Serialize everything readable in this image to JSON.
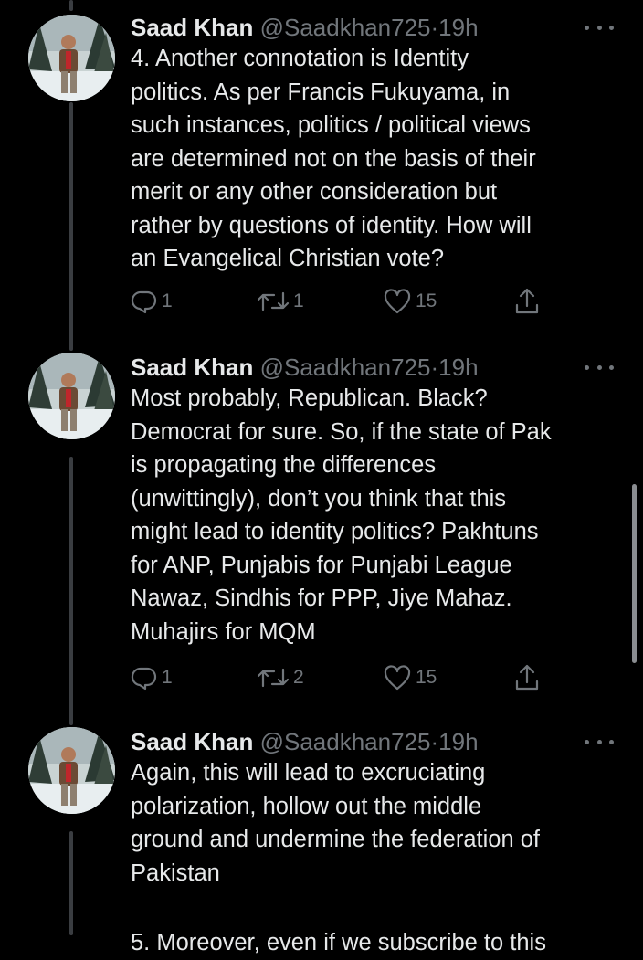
{
  "tweets": [
    {
      "name": "Saad Khan",
      "handle": "@Saadkhan725",
      "separator": "·",
      "time": "19h",
      "lines": [
        "4. Another connotation is Identity",
        "politics. As per Francis Fukuyama, in",
        "such instances,  politics / political views",
        "are determined not on the basis of their",
        "merit or any other consideration but",
        "rather by questions of identity. How will",
        "an Evangelical Christian vote?"
      ],
      "replies": "1",
      "retweets": "1",
      "likes": "15"
    },
    {
      "name": "Saad Khan",
      "handle": "@Saadkhan725",
      "separator": "·",
      "time": "19h",
      "lines": [
        "Most probably, Republican. Black?",
        "Democrat for sure. So, if the state of Pak",
        "is propagating the differences",
        "(unwittingly), don’t you think that this",
        "might lead to identity politics? Pakhtuns",
        "for ANP, Punjabis for Punjabi League",
        "Nawaz, Sindhis for PPP, Jiye Mahaz.",
        "Muhajirs for MQM"
      ],
      "replies": "1",
      "retweets": "2",
      "likes": "15"
    },
    {
      "name": "Saad Khan",
      "handle": "@Saadkhan725",
      "separator": "·",
      "time": "19h",
      "lines": [
        "Again, this will lead to excruciating",
        "polarization, hollow out the middle",
        "ground and undermine the federation of",
        "Pakistan"
      ]
    }
  ],
  "next_tweet_partial": "5. Moreover, even if we subscribe to this",
  "icons": {
    "reply": "reply-icon",
    "retweet": "retweet-icon",
    "like": "heart-icon",
    "share": "share-icon",
    "more": "more-options-icon"
  },
  "colors": {
    "background": "#000000",
    "text": "#e7e9ea",
    "secondary": "#71767b",
    "thread_line": "#3a3d41"
  }
}
